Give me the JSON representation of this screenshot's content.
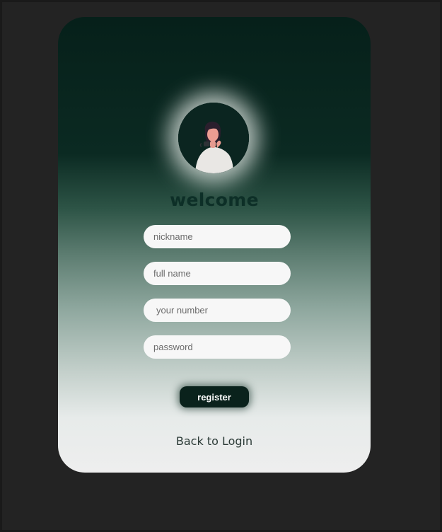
{
  "card": {
    "title": "welcome"
  },
  "form": {
    "nickname_placeholder": "nickname",
    "fullname_placeholder": "full name",
    "number_placeholder": "your number",
    "password_placeholder": "password",
    "register_label": "register"
  },
  "footer": {
    "back_label": "Back to Login"
  },
  "colors": {
    "card_top": "#06201a",
    "card_bottom": "#eeeeee",
    "button": "#0a221c",
    "page_bg": "#232323"
  },
  "icons": {
    "avatar": "user-avatar-illustration"
  }
}
